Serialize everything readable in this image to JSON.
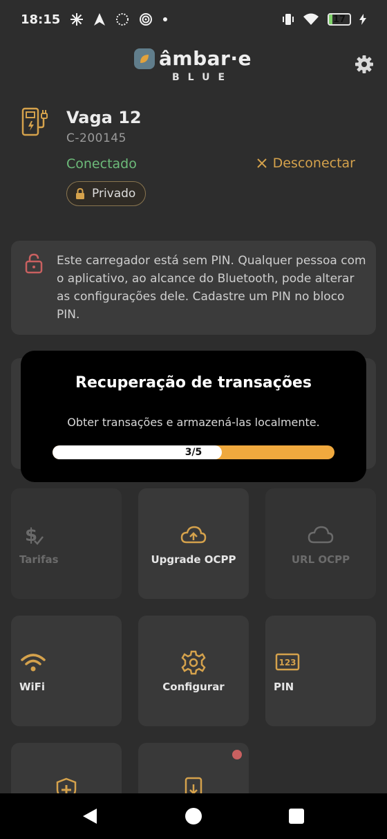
{
  "status_bar": {
    "time": "18:15",
    "battery": "17",
    "battery_level": 0.17
  },
  "header": {
    "logo_text": "âmbar·e",
    "logo_sub": "BLUE"
  },
  "charger": {
    "name": "Vaga 12",
    "id": "C-200145",
    "status": "Conectado",
    "disconnect_label": "Desconectar",
    "privacy_label": "Privado"
  },
  "pin_warning": {
    "text": "Este carregador está sem PIN. Qualquer pessoa com o aplicativo, ao alcance do Bluetooth, pode alterar as configurações dele. Cadastre um PIN no bloco PIN."
  },
  "modal": {
    "title": "Recuperação de transações",
    "description": "Obter transações e armazená-las localmente.",
    "progress_text": "3/5",
    "progress_current": 3,
    "progress_total": 5
  },
  "tiles": {
    "tarifas": "Tarifas",
    "upgrade_ocpp": "Upgrade OCPP",
    "url_ocpp": "URL OCPP",
    "wifi": "WiFi",
    "configurar": "Configurar",
    "pin": "PIN"
  },
  "colors": {
    "accent": "#d5a24c",
    "connected": "#6dbb7a",
    "background": "#2d2d2d",
    "tile": "#393939",
    "progress": "#f0a93e"
  }
}
